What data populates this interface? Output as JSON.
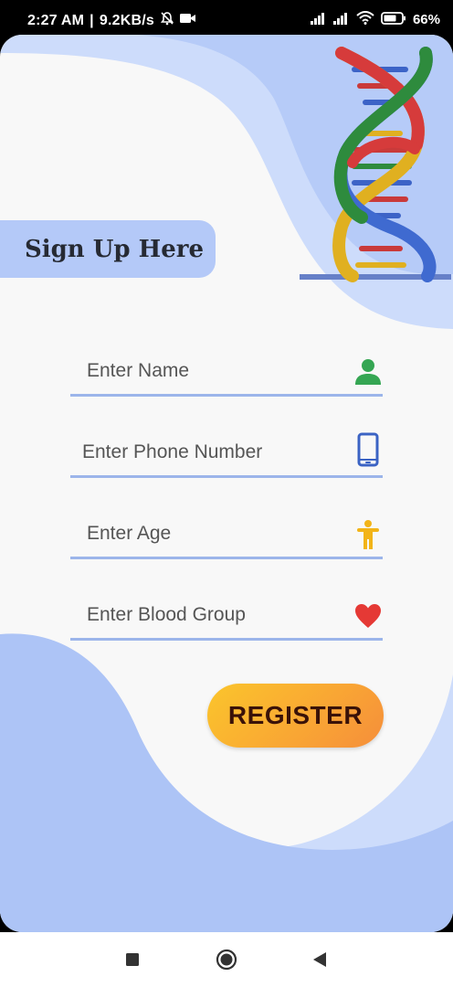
{
  "status_bar": {
    "time": "2:27 AM",
    "separator": "|",
    "speed": "9.2KB/s",
    "battery": "66%",
    "icons": [
      "mute-alarm-icon",
      "video-camera-icon",
      "signal-icon",
      "signal-icon",
      "wifi-icon",
      "battery-icon"
    ]
  },
  "header": {
    "title": "Sign Up Here"
  },
  "form": {
    "fields": [
      {
        "placeholder": "Enter Name",
        "icon": "person-icon",
        "icon_color": "#35a653"
      },
      {
        "placeholder": "Enter Phone Number",
        "icon": "phone-icon",
        "icon_color": "#3b63c4"
      },
      {
        "placeholder": "Enter Age",
        "icon": "child-figure-icon",
        "icon_color": "#f2b418"
      },
      {
        "placeholder": "Enter Blood Group",
        "icon": "heart-icon",
        "icon_color": "#e53935"
      }
    ],
    "register_label": "REGISTER"
  },
  "nav_bar": {
    "icons": [
      "recents-square-icon",
      "home-circle-icon",
      "back-triangle-icon"
    ]
  },
  "colors": {
    "accent_blue": "#9cb5ea",
    "wave_light": "#cddcfb",
    "wave_mid": "#adc4f6",
    "button_start": "#fbc52c",
    "button_end": "#f58e3b",
    "button_text": "#3a1208"
  }
}
